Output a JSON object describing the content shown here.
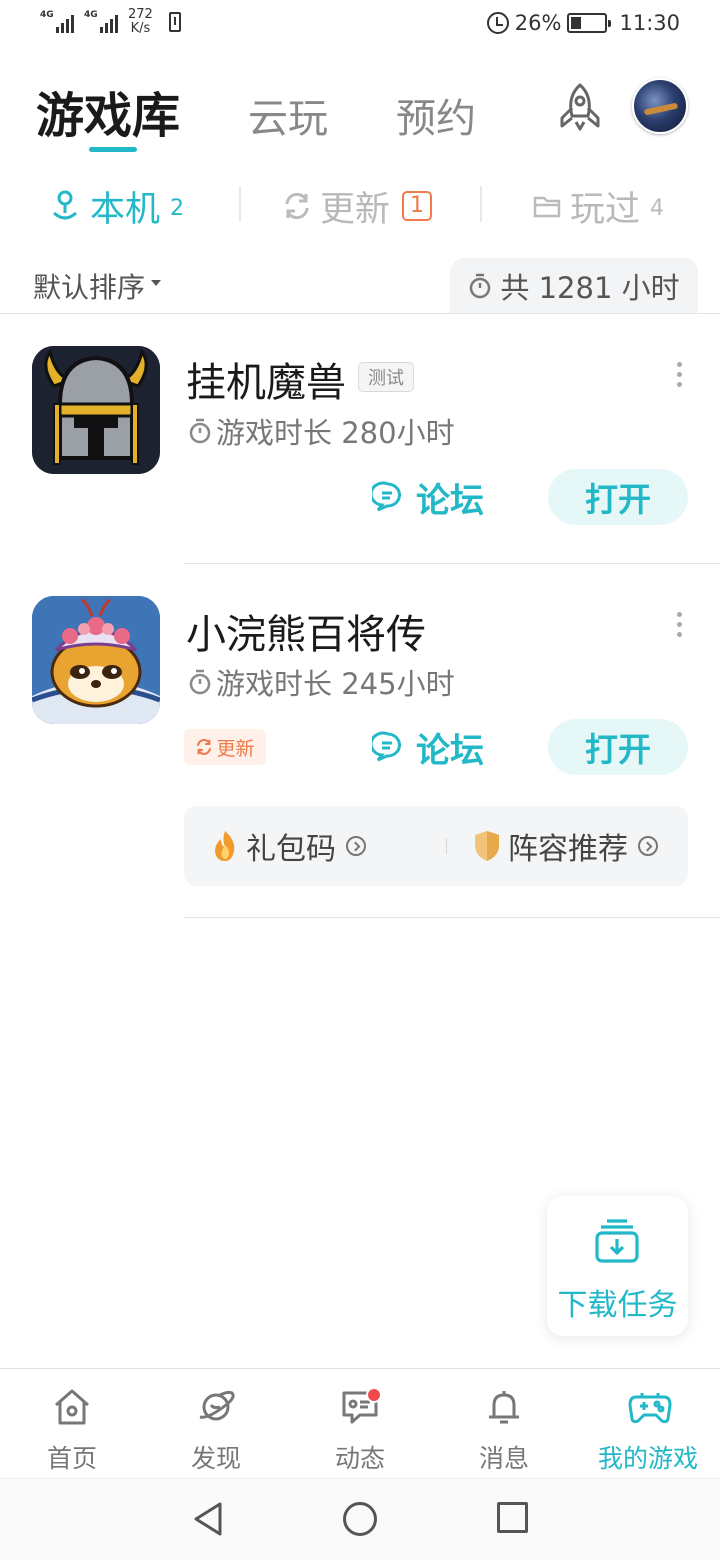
{
  "status_bar": {
    "network_1": "4G",
    "network_2": "4G",
    "net_speed_value": "272",
    "net_speed_unit": "K/s",
    "battery_percent": "26%",
    "time": "11:30"
  },
  "top_tabs": [
    {
      "label": "游戏库",
      "active": true
    },
    {
      "label": "云玩",
      "active": false
    },
    {
      "label": "预约",
      "active": false
    }
  ],
  "sub_tabs": [
    {
      "label": "本机",
      "count": "2",
      "icon": "device-icon",
      "active": true
    },
    {
      "label": "更新",
      "count": "1",
      "icon": "refresh-icon",
      "active": false
    },
    {
      "label": "玩过",
      "count": "4",
      "icon": "folder-icon",
      "active": false
    }
  ],
  "sort": {
    "label": "默认排序"
  },
  "total_time": "共 1281 小时",
  "games": [
    {
      "name": "挂机魔兽",
      "tag": "测试",
      "playtime": "游戏时长 280小时",
      "forum_label": "论坛",
      "open_label": "打开"
    },
    {
      "name": "小浣熊百将传",
      "playtime": "游戏时长 245小时",
      "update_tag": "更新",
      "forum_label": "论坛",
      "open_label": "打开",
      "extras": [
        {
          "label": "礼包码",
          "icon": "fire-icon"
        },
        {
          "label": "阵容推荐",
          "icon": "shield-icon"
        }
      ]
    }
  ],
  "download_task": {
    "label": "下载任务"
  },
  "bottom_nav": [
    {
      "label": "首页",
      "icon": "home-icon",
      "active": false
    },
    {
      "label": "发现",
      "icon": "planet-icon",
      "active": false
    },
    {
      "label": "动态",
      "icon": "chat-icon",
      "active": false,
      "badge": true
    },
    {
      "label": "消息",
      "icon": "bell-icon",
      "active": false
    },
    {
      "label": "我的游戏",
      "icon": "gamepad-icon",
      "active": true
    }
  ],
  "colors": {
    "accent": "#22b8c8",
    "accent_light": "#e6f7f8",
    "update_orange": "#f07a4a",
    "badge_red": "#f04b4b"
  }
}
